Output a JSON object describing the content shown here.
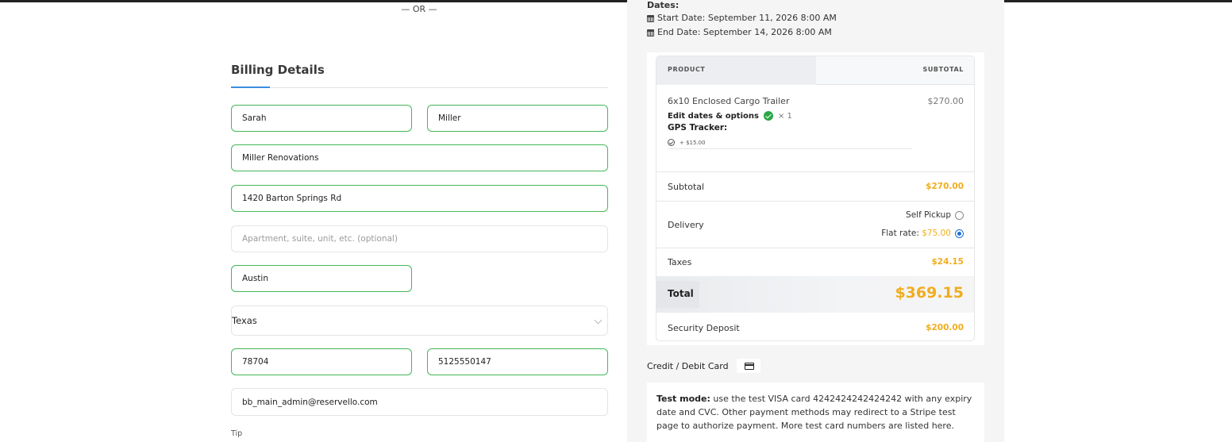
{
  "left": {
    "or_separator": "— OR —",
    "billing_title": "Billing Details",
    "fields": {
      "first_name": "Sarah",
      "last_name": "Miller",
      "company": "Miller Renovations",
      "address1": "1420 Barton Springs Rd",
      "address2_placeholder": "Apartment, suite, unit, etc. (optional)",
      "city": "Austin",
      "state": "Texas",
      "zip": "78704",
      "phone": "5125550147",
      "email": "bb_main_admin@reservello.com"
    },
    "tip_label": "Tip"
  },
  "right": {
    "dates_title": "Dates:",
    "start_date": "Start Date: September 11, 2026 8:00 AM",
    "end_date": "End Date: September 14, 2026 8:00 AM",
    "table": {
      "header_product": "PRODUCT",
      "header_subtotal": "SUBTOTAL",
      "item": {
        "name": "6x10 Enclosed Cargo Trailer",
        "price": "$270.00",
        "edit_label": "Edit dates & options",
        "quantity": "× 1",
        "option_title": "GPS Tracker:",
        "option_price": "+ $15.00"
      },
      "subtotal_label": "Subtotal",
      "subtotal_value": "$270.00",
      "delivery_label": "Delivery",
      "delivery_options": [
        {
          "label": "Self Pickup",
          "price": "",
          "selected": false
        },
        {
          "label": "Flat rate: ",
          "price": "$75.00",
          "selected": true
        }
      ],
      "taxes_label": "Taxes",
      "taxes_value": "$24.15",
      "total_label": "Total",
      "total_value": "$369.15",
      "deposit_label": "Security Deposit",
      "deposit_value": "$200.00"
    },
    "payment": {
      "method_label": "Credit / Debit Card",
      "card_icon": "credit-card-icon",
      "test_mode_strong": "Test mode:",
      "test_mode_text": " use the test VISA card 4242424242424242 with any expiry date and CVC. Other payment methods may redirect to a Stripe test page to authorize payment. More test card numbers are listed "
    },
    "payment_link": "here",
    "payment_end": "."
  },
  "colors": {
    "accent_green": "#44b85a",
    "price_orange": "#f0ad1e",
    "tab_blue": "#3b8de0",
    "radio_blue": "#1c6fd6"
  }
}
